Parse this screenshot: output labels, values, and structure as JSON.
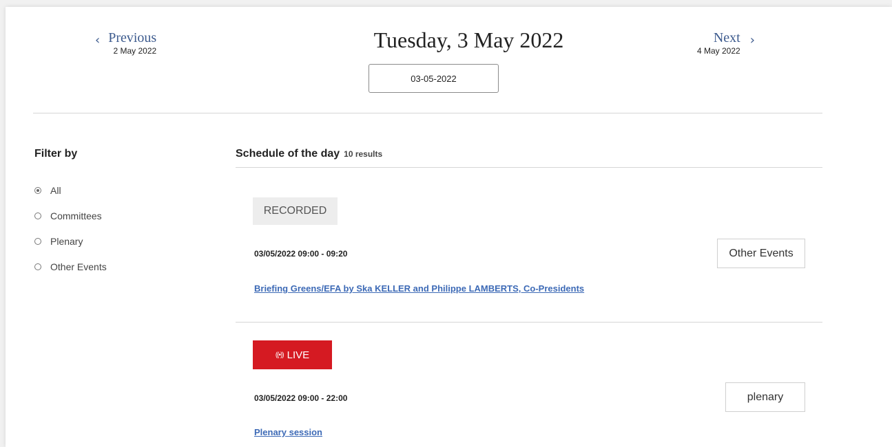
{
  "nav": {
    "previous_label": "Previous",
    "previous_date": "2 May 2022",
    "next_label": "Next",
    "next_date": "4 May 2022",
    "current_title": "Tuesday, 3 May 2022",
    "date_input_value": "03-05-2022",
    "prev_icon": "‹",
    "next_icon": "›"
  },
  "filter": {
    "title": "Filter by",
    "options": [
      "All",
      "Committees",
      "Plenary",
      "Other Events"
    ],
    "selected": "All"
  },
  "schedule": {
    "heading": "Schedule of the day",
    "count": "10 results",
    "events": [
      {
        "status": "RECORDED",
        "time": "03/05/2022 09:00 - 09:20",
        "type": "Other Events",
        "title": "Briefing Greens/EFA by Ska KELLER and Philippe LAMBERTS, Co-Presidents"
      },
      {
        "status": "LIVE",
        "status_icon": "((•))",
        "time": "03/05/2022 09:00 - 22:00",
        "type": "plenary",
        "title": "Plenary session"
      }
    ]
  },
  "colors": {
    "link": "#3d6ab6",
    "nav_link": "#3d5b8e",
    "live": "#d51a22",
    "recorded_bg": "#ededed"
  }
}
